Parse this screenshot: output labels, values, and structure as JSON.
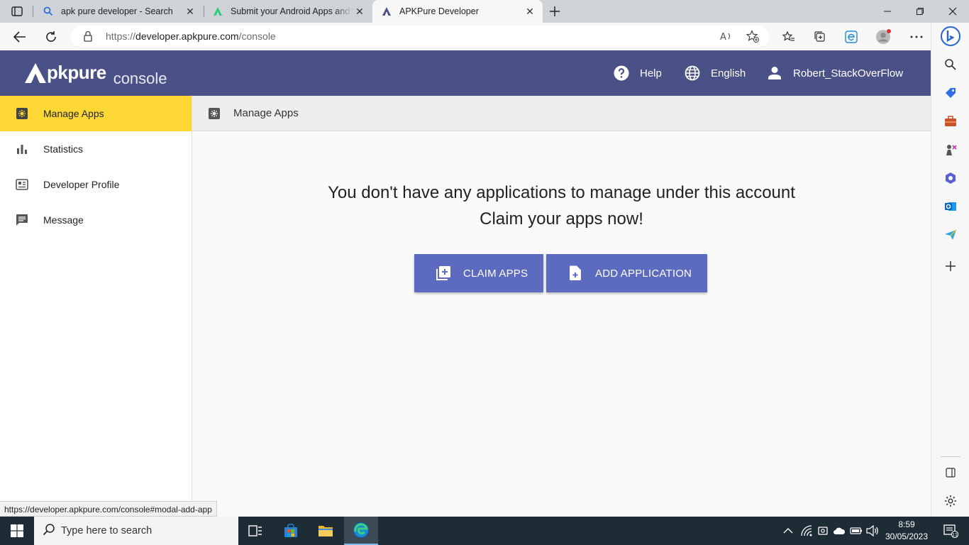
{
  "browser": {
    "tabs": [
      {
        "title": "apk pure developer - Search",
        "active": false
      },
      {
        "title": "Submit your Android Apps and g",
        "active": false
      },
      {
        "title": "APKPure Developer",
        "active": true
      }
    ],
    "url_prefix": "https://",
    "url_host": "developer.apkpure.com",
    "url_path": "/console"
  },
  "header": {
    "logo_brand": "pkpure",
    "logo_sub": "console",
    "help_label": "Help",
    "language_label": "English",
    "user_name": "Robert_StackOverFlow"
  },
  "sidebar": {
    "items": [
      {
        "label": "Manage Apps",
        "active": true
      },
      {
        "label": "Statistics",
        "active": false
      },
      {
        "label": "Developer Profile",
        "active": false
      },
      {
        "label": "Message",
        "active": false
      }
    ]
  },
  "main": {
    "section_title": "Manage Apps",
    "message_line1": "You don't have any applications to manage under this account",
    "message_line2": "Claim your apps now!",
    "claim_button": "CLAIM APPS",
    "add_button": "ADD APPLICATION"
  },
  "status_link": "https://developer.apkpure.com/console#modal-add-app",
  "taskbar": {
    "search_placeholder": "Type here to search",
    "time": "8:59",
    "date": "30/05/2023",
    "notification_count": "11"
  },
  "colors": {
    "header_bg": "#4a5186",
    "active_nav": "#fdd835",
    "button_bg": "#5c6bc0",
    "taskbar_bg": "#1e2c35"
  }
}
